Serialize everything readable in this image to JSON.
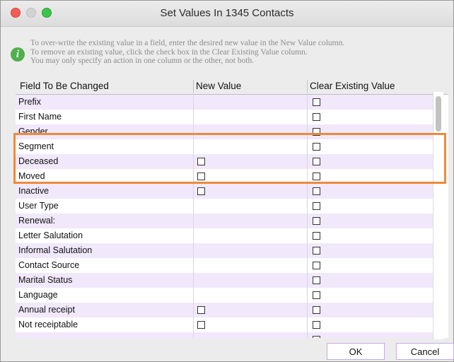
{
  "window": {
    "title": "Set Values In 1345 Contacts"
  },
  "info": {
    "icon": "info-icon",
    "lines": [
      "To over-write the existing value in a field, enter the desired new value in the New Value column.",
      "To remove an existing value, click the check box in the Clear Existing Value column.",
      "You may only specify an action in one column or the other, not both."
    ]
  },
  "table": {
    "columns": [
      "Field To Be Changed",
      "New Value",
      "Clear Existing Value"
    ],
    "rows": [
      {
        "field": "Prefix",
        "new_checkbox": false
      },
      {
        "field": "First Name",
        "new_checkbox": false
      },
      {
        "field": "Gender",
        "new_checkbox": false
      },
      {
        "field": "Segment",
        "new_checkbox": false
      },
      {
        "field": "Deceased",
        "new_checkbox": true
      },
      {
        "field": "Moved",
        "new_checkbox": true
      },
      {
        "field": "Inactive",
        "new_checkbox": true
      },
      {
        "field": "User Type",
        "new_checkbox": false
      },
      {
        "field": "Renewal:",
        "new_checkbox": false
      },
      {
        "field": "Letter Salutation",
        "new_checkbox": false
      },
      {
        "field": "Informal Salutation",
        "new_checkbox": false
      },
      {
        "field": "Contact Source",
        "new_checkbox": false
      },
      {
        "field": "Marital Status",
        "new_checkbox": false
      },
      {
        "field": "Language",
        "new_checkbox": false
      },
      {
        "field": "Annual receipt",
        "new_checkbox": true
      },
      {
        "field": "Not receiptable",
        "new_checkbox": true
      },
      {
        "field": "",
        "new_checkbox": false
      }
    ]
  },
  "highlight_color": "#ef8a3a",
  "buttons": {
    "ok": "OK",
    "cancel": "Cancel"
  }
}
